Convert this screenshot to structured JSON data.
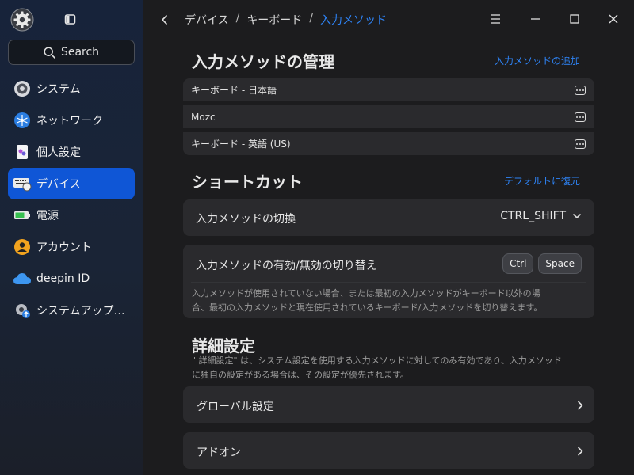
{
  "sidebar": {
    "search_label": "Search",
    "items": [
      {
        "label": "システム",
        "icon": "system-icon",
        "active": false
      },
      {
        "label": "ネットワーク",
        "icon": "network-icon",
        "active": false
      },
      {
        "label": "個人設定",
        "icon": "personalization-icon",
        "active": false
      },
      {
        "label": "デバイス",
        "icon": "device-icon",
        "active": true
      },
      {
        "label": "電源",
        "icon": "power-icon",
        "active": false
      },
      {
        "label": "アカウント",
        "icon": "account-icon",
        "active": false
      },
      {
        "label": "deepin ID",
        "icon": "cloud-icon",
        "active": false
      },
      {
        "label": "システムアップ…",
        "icon": "system-update-icon",
        "active": false
      }
    ]
  },
  "header": {
    "breadcrumb": [
      "デバイス",
      "キーボード",
      "入力メソッド"
    ],
    "separator": "/"
  },
  "input_methods": {
    "title": "入力メソッドの管理",
    "add_link": "入力メソッドの追加",
    "items": [
      "キーボード - 日本語",
      "Mozc",
      "キーボード - 英語 (US)"
    ]
  },
  "shortcuts": {
    "title": "ショートカット",
    "reset_link": "デフォルトに復元",
    "switch_label": "入力メソッドの切換",
    "switch_value": "CTRL_SHIFT",
    "toggle_label": "入力メソッドの有効/無効の切り替え",
    "toggle_keys": [
      "Ctrl",
      "Space"
    ],
    "toggle_desc_1": "入力メソッドが使用されていない場合、または最初の入力メソッドがキーボード以外の場",
    "toggle_desc_2": "合、最初の入力メソッドと現在使用されているキーボード/入力メソッドを切り替えます。"
  },
  "advanced": {
    "title": "詳細設定",
    "desc_1": "\" 詳細設定\" は、システム設定を使用する入力メソッドに対してのみ有効であり、入力メソッド",
    "desc_2": "に独自の設定がある場合は、その設定が優先されます。",
    "global_label": "グローバル設定",
    "addon_label": "アドオン"
  },
  "colors": {
    "accent": "#0f56d6",
    "link": "#2e83f5",
    "card": "#2a2a2d",
    "background": "#1c1c1e"
  }
}
